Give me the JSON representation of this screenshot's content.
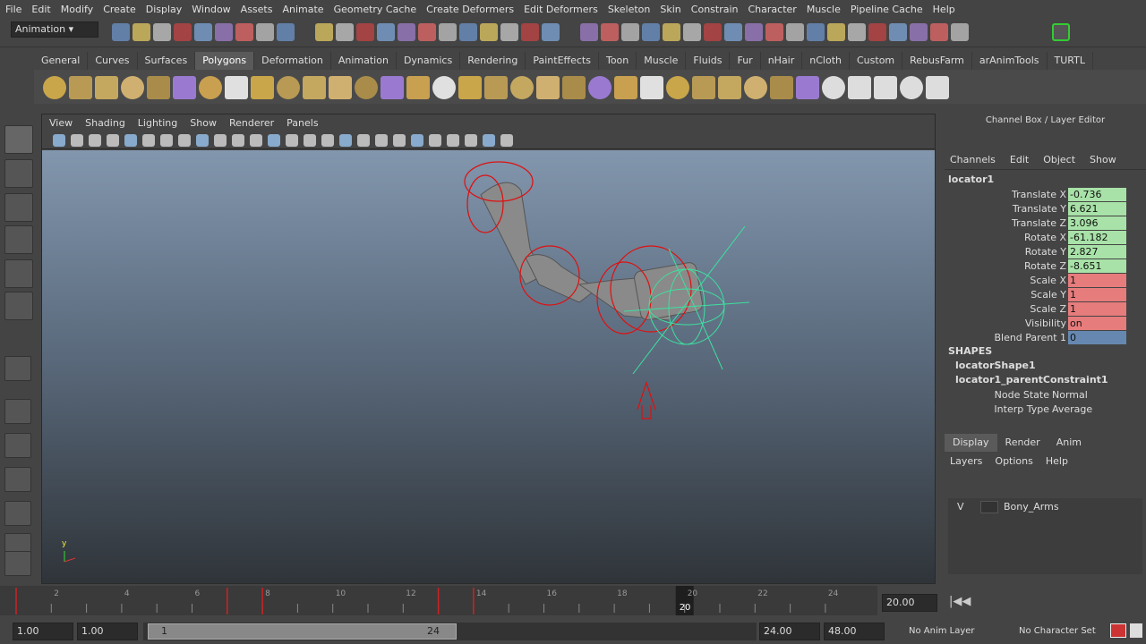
{
  "menu": [
    "File",
    "Edit",
    "Modify",
    "Create",
    "Display",
    "Window",
    "Assets",
    "Animate",
    "Geometry Cache",
    "Create Deformers",
    "Edit Deformers",
    "Skeleton",
    "Skin",
    "Constrain",
    "Character",
    "Muscle",
    "Pipeline Cache",
    "Help"
  ],
  "status": {
    "mode": "Animation"
  },
  "shelf_tabs": [
    "General",
    "Curves",
    "Surfaces",
    "Polygons",
    "Deformation",
    "Animation",
    "Dynamics",
    "Rendering",
    "PaintEffects",
    "Toon",
    "Muscle",
    "Fluids",
    "Fur",
    "nHair",
    "nCloth",
    "Custom",
    "RebusFarm",
    "arAnimTools",
    "TURTL"
  ],
  "active_shelf": "Polygons",
  "panel_menu": [
    "View",
    "Shading",
    "Lighting",
    "Show",
    "Renderer",
    "Panels"
  ],
  "channel_box": {
    "title": "Channel Box / Layer Editor",
    "menu": [
      "Channels",
      "Edit",
      "Object",
      "Show"
    ],
    "object": "locator1",
    "channels": [
      {
        "label": "Translate X",
        "value": "-0.736",
        "color": "#a8e2a8"
      },
      {
        "label": "Translate Y",
        "value": "6.621",
        "color": "#a8e2a8"
      },
      {
        "label": "Translate Z",
        "value": "3.096",
        "color": "#a8e2a8"
      },
      {
        "label": "Rotate X",
        "value": "-61.182",
        "color": "#a8e2a8"
      },
      {
        "label": "Rotate Y",
        "value": "2.827",
        "color": "#a8e2a8"
      },
      {
        "label": "Rotate Z",
        "value": "-8.651",
        "color": "#a8e2a8"
      },
      {
        "label": "Scale X",
        "value": "1",
        "color": "#e77c7c"
      },
      {
        "label": "Scale Y",
        "value": "1",
        "color": "#e77c7c"
      },
      {
        "label": "Scale Z",
        "value": "1",
        "color": "#e77c7c"
      },
      {
        "label": "Visibility",
        "value": "on",
        "color": "#e77c7c"
      },
      {
        "label": "Blend Parent 1",
        "value": "0",
        "color": "#6688b0"
      }
    ],
    "shapes_header": "SHAPES",
    "shapes": [
      "locatorShape1",
      "locator1_parentConstraint1"
    ],
    "inputs": [
      {
        "label": "Node State",
        "value": "Normal"
      },
      {
        "label": "Interp Type",
        "value": "Average"
      }
    ]
  },
  "layer_editor": {
    "tabs": [
      "Display",
      "Render",
      "Anim"
    ],
    "active": "Display",
    "menu": [
      "Layers",
      "Options",
      "Help"
    ],
    "layers": [
      {
        "visible": "V",
        "name": "Bony_Arms"
      }
    ]
  },
  "timeline": {
    "ticks": [
      "2",
      "4",
      "6",
      "8",
      "10",
      "12",
      "14",
      "16",
      "18",
      "20",
      "22",
      "24"
    ],
    "current_frame": "20",
    "current_time": "20.00",
    "keys": [
      1,
      7,
      8,
      13,
      14
    ]
  },
  "range": {
    "start": "1.00",
    "playback_start": "1.00",
    "slider_start": "1",
    "slider_end": "24",
    "playback_end": "24.00",
    "end": "48.00",
    "anim_layer": "No Anim Layer",
    "character_set": "No Character Set"
  }
}
